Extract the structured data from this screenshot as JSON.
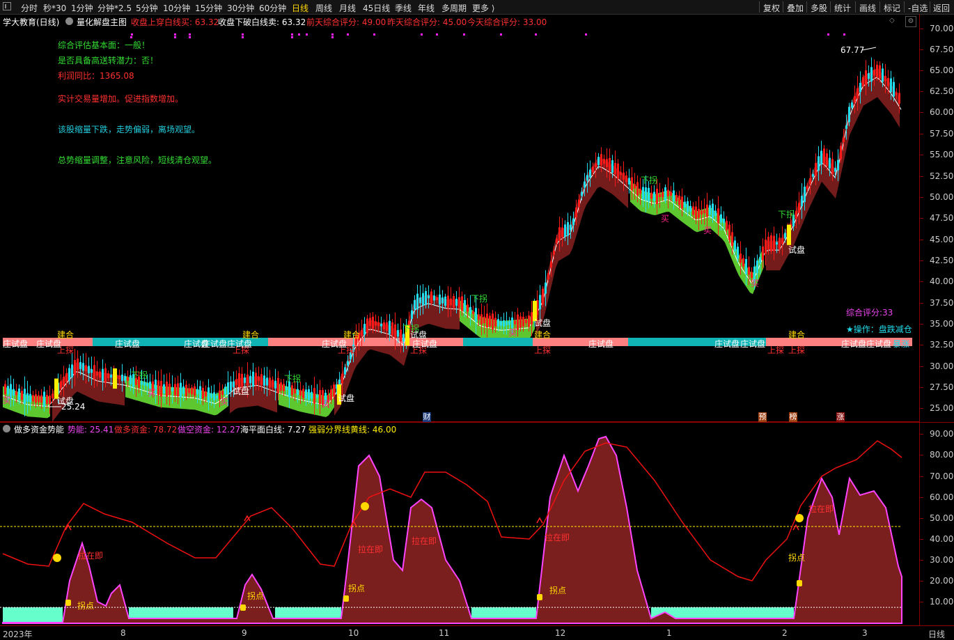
{
  "toolbar": {
    "periods": [
      "分时",
      "秒*30",
      "1分钟",
      "分钟*2.5",
      "5分钟",
      "10分钟",
      "15分钟",
      "30分钟",
      "60分钟",
      "日线",
      "周线",
      "月线",
      "45日线",
      "季线",
      "年线",
      "多周期",
      "更多 ⟩"
    ],
    "active_period": "日线",
    "right_tools": [
      "复权",
      "叠加",
      "多股",
      "统计",
      "画线",
      "标记",
      "-自选",
      "返回"
    ]
  },
  "main_header": {
    "stock": "学大教育(日线)",
    "indicator": "量化解盘主图",
    "buy_line": "收盘上穿白线买: 63.32",
    "sell_line": "收盘下破白线卖: 63.32",
    "score_before": "前天综合评分: 49.00",
    "score_yesterday": "昨天综合评分: 45.00",
    "score_today": "今天综合评分: 33.00"
  },
  "notes": [
    {
      "text": "综合评估基本面：一般！",
      "color": "#33dd33"
    },
    {
      "text": "是否具备高送转潜力：否！",
      "color": "#33dd33"
    },
    {
      "text": "利润同比：1365.08",
      "color": "#ff3030"
    },
    {
      "text": "实计交易量增加。促进指数增加。",
      "color": "#ff3030"
    },
    {
      "text": "该股缩量下跌，走势偏弱，离场观望。",
      "color": "#22ccdd"
    },
    {
      "text": "总势缩量调整，注意风险，短线清仓观望。",
      "color": "#33dd33"
    }
  ],
  "main_labels": {
    "high_price": "67.77",
    "low_price": "25.24",
    "score": "综合评分:33",
    "operation": "★操作：盘跌减仓",
    "dip": "下拐",
    "probe": "试盘",
    "buy": "买",
    "build": "建合",
    "up": "上探",
    "banker": "庄试盘",
    "baozhang": "暴涨",
    "caishen": "财",
    "yu": "预",
    "bang": "榜",
    "zhang": "涨"
  },
  "main_yaxis": [
    "70.00",
    "67.50",
    "65.00",
    "62.50",
    "60.00",
    "57.50",
    "55.00",
    "52.50",
    "50.00",
    "47.50",
    "45.00",
    "42.50",
    "40.00",
    "37.50",
    "35.00",
    "32.50",
    "30.00",
    "27.50",
    "25.00"
  ],
  "sub_header": {
    "indicator": "做多资金势能",
    "momentum": "势能: 25.41",
    "long_fund": "做多资金: 78.72",
    "short_fund": "做空资金: 12.27",
    "sea_level": "海平面白线: 7.27",
    "boundary": "强弱分界线黄线: 46.00"
  },
  "sub_labels": {
    "turn": "拐点",
    "pull": "拉在即"
  },
  "sub_yaxis": [
    "90.00",
    "80.00",
    "70.00",
    "60.00",
    "50.00",
    "40.00",
    "30.00",
    "20.00",
    "10.00"
  ],
  "xaxis": {
    "labels": [
      "2023年",
      "8",
      "9",
      "10",
      "11",
      "12",
      "1",
      "2",
      "3"
    ],
    "period": "日线"
  },
  "colors": {
    "up": "#ff1a1a",
    "down": "#22ddee",
    "ribbon_up": "#7a1e1e",
    "ribbon_down": "#66dd33",
    "banker_red": "#ff8080",
    "banker_cyan": "#11b4b4",
    "momentum": "#7a1e1e",
    "momentum_edge": "#ff44ff",
    "long_fund": "#ee1111",
    "sea": "#66ffcc",
    "boundary": "#ffee00"
  }
}
